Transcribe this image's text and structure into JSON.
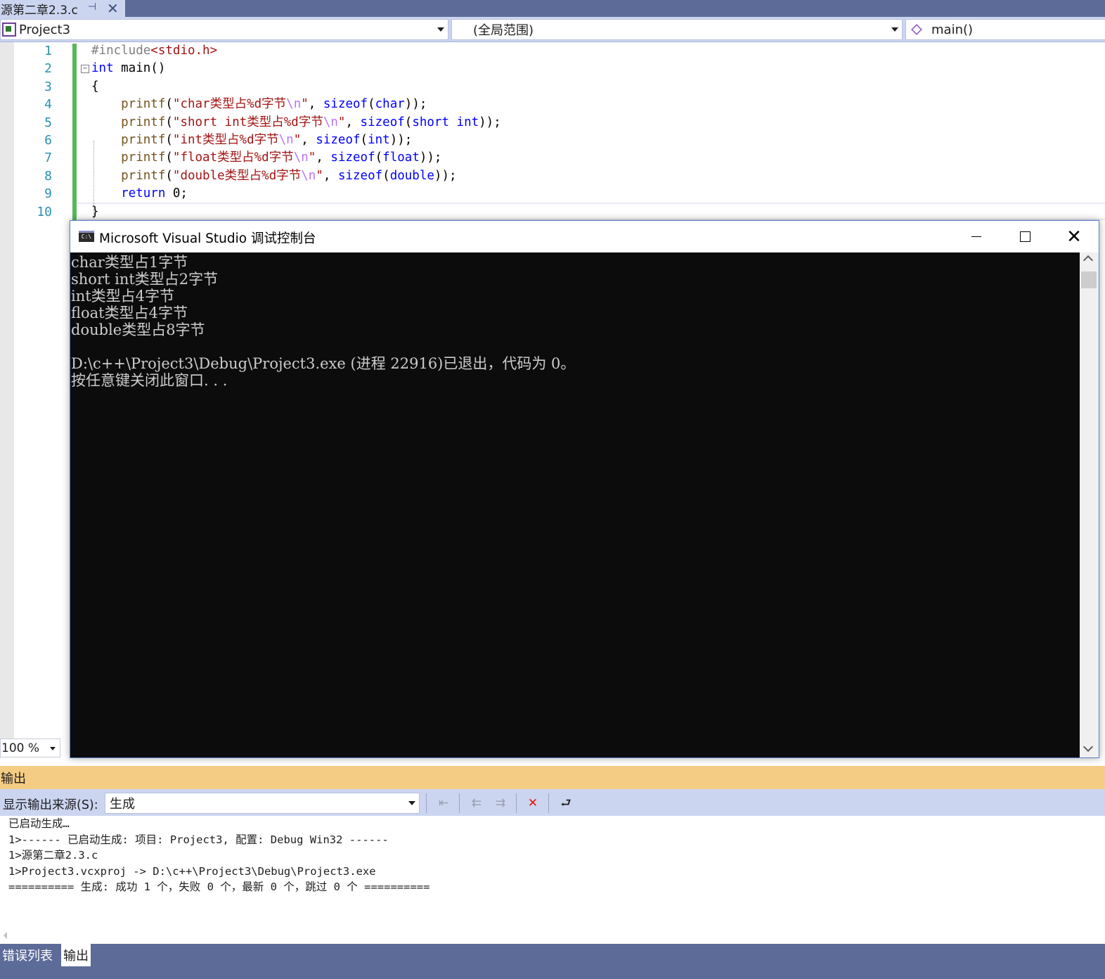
{
  "document_tab": {
    "title": "源第二章2.3.c"
  },
  "navigation": {
    "project": "Project3",
    "scope": "(全局范围)",
    "member": "main()"
  },
  "editor": {
    "line_numbers": [
      "1",
      "2",
      "3",
      "4",
      "5",
      "6",
      "7",
      "8",
      "9",
      "10"
    ],
    "lines": [
      [
        {
          "t": "#include",
          "c": "pp"
        },
        {
          "t": "<stdio.h>",
          "c": "str"
        }
      ],
      [
        {
          "t": "int",
          "c": "kw"
        },
        {
          "t": " main()",
          "c": ""
        }
      ],
      [
        {
          "t": "{",
          "c": ""
        }
      ],
      [
        {
          "t": "    printf",
          "c": "fn"
        },
        {
          "t": "(",
          "c": ""
        },
        {
          "t": "\"char类型占%d字节",
          "c": "str"
        },
        {
          "t": "\\n",
          "c": "esc"
        },
        {
          "t": "\"",
          "c": "str"
        },
        {
          "t": ", ",
          "c": ""
        },
        {
          "t": "sizeof",
          "c": "kw"
        },
        {
          "t": "(",
          "c": ""
        },
        {
          "t": "char",
          "c": "kw"
        },
        {
          "t": "));",
          "c": ""
        }
      ],
      [
        {
          "t": "    printf",
          "c": "fn"
        },
        {
          "t": "(",
          "c": ""
        },
        {
          "t": "\"short int类型占%d字节",
          "c": "str"
        },
        {
          "t": "\\n",
          "c": "esc"
        },
        {
          "t": "\"",
          "c": "str"
        },
        {
          "t": ", ",
          "c": ""
        },
        {
          "t": "sizeof",
          "c": "kw"
        },
        {
          "t": "(",
          "c": ""
        },
        {
          "t": "short int",
          "c": "kw"
        },
        {
          "t": "));",
          "c": ""
        }
      ],
      [
        {
          "t": "    printf",
          "c": "fn"
        },
        {
          "t": "(",
          "c": ""
        },
        {
          "t": "\"int类型占%d字节",
          "c": "str"
        },
        {
          "t": "\\n",
          "c": "esc"
        },
        {
          "t": "\"",
          "c": "str"
        },
        {
          "t": ", ",
          "c": ""
        },
        {
          "t": "sizeof",
          "c": "kw"
        },
        {
          "t": "(",
          "c": ""
        },
        {
          "t": "int",
          "c": "kw"
        },
        {
          "t": "));",
          "c": ""
        }
      ],
      [
        {
          "t": "    printf",
          "c": "fn"
        },
        {
          "t": "(",
          "c": ""
        },
        {
          "t": "\"float类型占%d字节",
          "c": "str"
        },
        {
          "t": "\\n",
          "c": "esc"
        },
        {
          "t": "\"",
          "c": "str"
        },
        {
          "t": ", ",
          "c": ""
        },
        {
          "t": "sizeof",
          "c": "kw"
        },
        {
          "t": "(",
          "c": ""
        },
        {
          "t": "float",
          "c": "kw"
        },
        {
          "t": "));",
          "c": ""
        }
      ],
      [
        {
          "t": "    printf",
          "c": "fn"
        },
        {
          "t": "(",
          "c": ""
        },
        {
          "t": "\"double类型占%d字节",
          "c": "str"
        },
        {
          "t": "\\n",
          "c": "esc"
        },
        {
          "t": "\"",
          "c": "str"
        },
        {
          "t": ", ",
          "c": ""
        },
        {
          "t": "sizeof",
          "c": "kw"
        },
        {
          "t": "(",
          "c": ""
        },
        {
          "t": "double",
          "c": "kw"
        },
        {
          "t": "));",
          "c": ""
        }
      ],
      [
        {
          "t": "    return",
          "c": "kw"
        },
        {
          "t": " 0;",
          "c": ""
        }
      ],
      [
        {
          "t": "}",
          "c": ""
        }
      ]
    ],
    "zoom": "100 %"
  },
  "console": {
    "title": "Microsoft Visual Studio 调试控制台",
    "icon_label": "C:\\",
    "lines": [
      "char类型占1字节",
      "short int类型占2字节",
      "int类型占4字节",
      "float类型占4字节",
      "double类型占8字节",
      "",
      "D:\\c++\\Project3\\Debug\\Project3.exe (进程 22916)已退出，代码为 0。",
      "按任意键关闭此窗口. . ."
    ]
  },
  "output_panel": {
    "title": "输出",
    "source_label": "显示输出来源(S):",
    "source_value": "生成",
    "lines": [
      "已启动生成…",
      "1>------ 已启动生成: 项目: Project3, 配置: Debug Win32 ------",
      "1>源第二章2.3.c",
      "1>Project3.vcxproj -> D:\\c++\\Project3\\Debug\\Project3.exe",
      "========== 生成: 成功 1 个，失败 0 个，最新 0 个，跳过 0 个 =========="
    ]
  },
  "bottom_tabs": {
    "errors": "错误列表",
    "output": "输出"
  },
  "colors": {
    "tab_strip": "#5d6b99",
    "toolbar": "#ccd5f0",
    "output_header": "#f5cc84",
    "console_bg": "#0c0c0c",
    "change_bar": "#57b85b",
    "keyword": "#0000ff",
    "string": "#a31515"
  },
  "icons": {
    "pin": "pin-icon",
    "close": "close-icon",
    "project": "cpp-project-icon",
    "member": "method-cube-icon",
    "console": "console-app-icon"
  }
}
